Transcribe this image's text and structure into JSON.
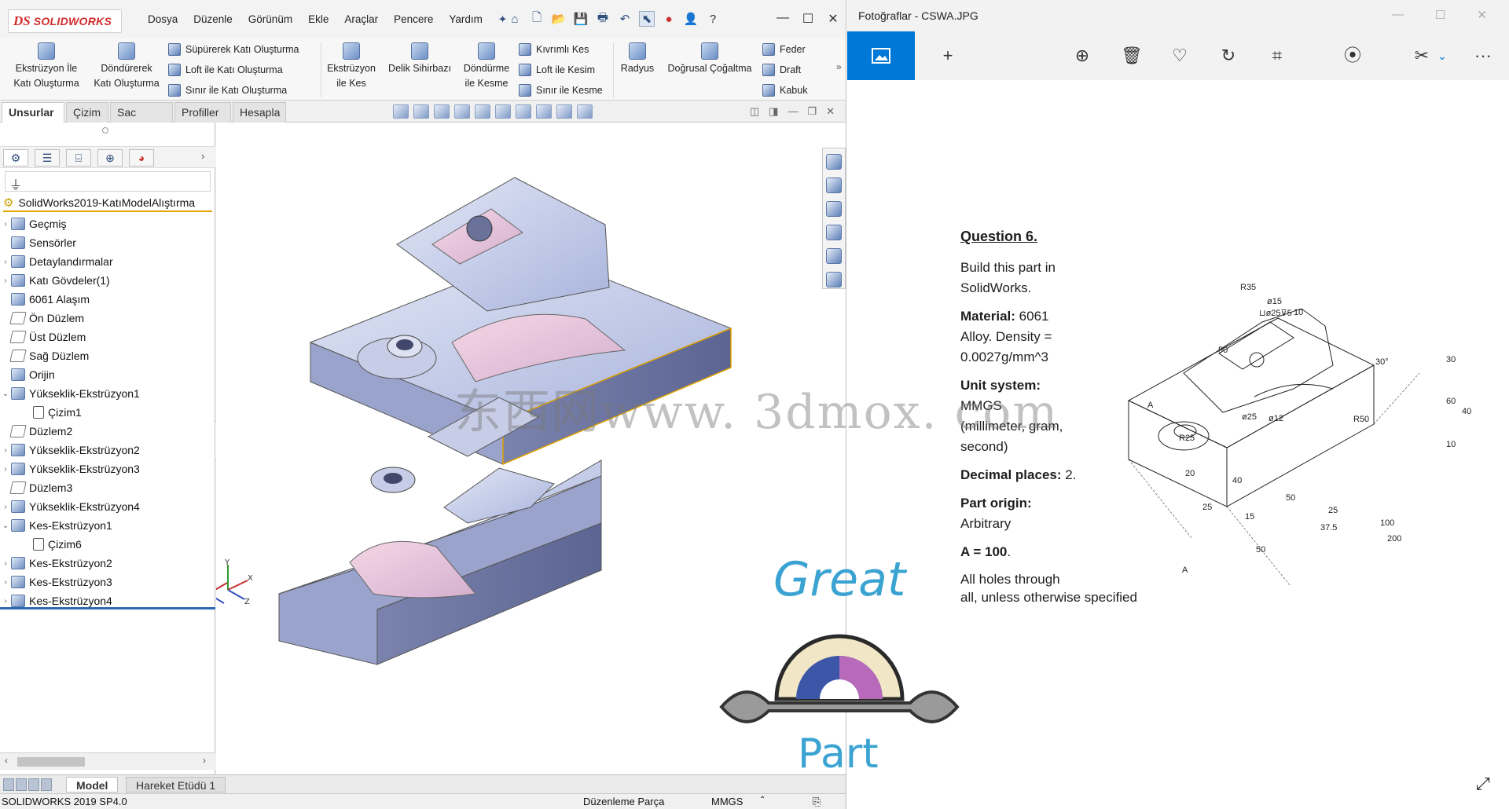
{
  "solidworks": {
    "logo_ds": "DS",
    "logo_name": "SOLIDWORKS",
    "menu": [
      "Dosya",
      "Düzenle",
      "Görünüm",
      "Ekle",
      "Araçlar",
      "Pencere",
      "Yardım"
    ],
    "ribbon": {
      "extrude_boss": "Ekstrüzyon İle\nKatı Oluşturma",
      "revolve_boss": "Döndürerek\nKatı Oluşturma",
      "sweep_boss": "Süpürerek Katı Oluşturma",
      "loft_boss": "Loft ile Katı Oluşturma",
      "boundary_boss": "Sınır ile Katı Oluşturma",
      "extrude_cut": "Ekstrüzyon\nile Kes",
      "hole_wizard": "Delik Sihirbazı",
      "revolve_cut": "Döndürme\nile Kesme",
      "swept_cut": "Kıvrımlı Kes",
      "loft_cut": "Loft ile Kesim",
      "boundary_cut": "Sınır ile Kesme",
      "fillet": "Radyus",
      "linear_pattern": "Doğrusal Çoğaltma",
      "rib": "Feder",
      "draft": "Draft",
      "shell": "Kabuk"
    },
    "tabs": [
      "Unsurlar",
      "Çizim",
      "Sac Levha",
      "Profiller",
      "Hesapla"
    ],
    "active_tab": "Unsurlar",
    "tree_root": "SolidWorks2019-KatıModelAlıştırma",
    "tree": [
      {
        "label": "Geçmiş",
        "arrow": "›",
        "icon": "history"
      },
      {
        "label": "Sensörler",
        "arrow": "",
        "icon": "sensor"
      },
      {
        "label": "Detaylandırmalar",
        "arrow": "›",
        "icon": "annotation"
      },
      {
        "label": "Katı Gövdeler(1)",
        "arrow": "›",
        "icon": "body"
      },
      {
        "label": "6061 Alaşım",
        "arrow": "",
        "icon": "material"
      },
      {
        "label": "Ön Düzlem",
        "arrow": "",
        "icon": "plane"
      },
      {
        "label": "Üst Düzlem",
        "arrow": "",
        "icon": "plane"
      },
      {
        "label": "Sağ Düzlem",
        "arrow": "",
        "icon": "plane"
      },
      {
        "label": "Orijin",
        "arrow": "",
        "icon": "origin"
      },
      {
        "label": "Yükseklik-Ekstrüzyon1",
        "arrow": "⌄",
        "icon": "feature"
      },
      {
        "label": "Çizim1",
        "arrow": "",
        "icon": "sketch",
        "indent": true
      },
      {
        "label": "Düzlem2",
        "arrow": "",
        "icon": "plane"
      },
      {
        "label": "Yükseklik-Ekstrüzyon2",
        "arrow": "›",
        "icon": "feature"
      },
      {
        "label": "Yükseklik-Ekstrüzyon3",
        "arrow": "›",
        "icon": "feature"
      },
      {
        "label": "Düzlem3",
        "arrow": "",
        "icon": "plane"
      },
      {
        "label": "Yükseklik-Ekstrüzyon4",
        "arrow": "›",
        "icon": "feature"
      },
      {
        "label": "Kes-Ekstrüzyon1",
        "arrow": "⌄",
        "icon": "feature"
      },
      {
        "label": "Çizim6",
        "arrow": "",
        "icon": "sketch",
        "indent": true
      },
      {
        "label": "Kes-Ekstrüzyon2",
        "arrow": "›",
        "icon": "feature"
      },
      {
        "label": "Kes-Ekstrüzyon3",
        "arrow": "›",
        "icon": "feature"
      },
      {
        "label": "Kes-Ekstrüzyon4",
        "arrow": "›",
        "icon": "feature"
      }
    ],
    "bottom_tabs": [
      "Model",
      "Hareket Etüdü 1"
    ],
    "status": {
      "version": "SOLIDWORKS 2019 SP4.0",
      "mode": "Düzenleme Parça",
      "units": "MMGS"
    }
  },
  "photos": {
    "title": "Fotoğraflar - CSWA.JPG",
    "sheet": {
      "question": "Question 6.",
      "build_1": "Build this part in",
      "build_2": "SolidWorks.",
      "material_label": "Material:",
      "material_value": "6061",
      "material_2": "Alloy.  Density =",
      "material_3": "0.0027g/mm^3",
      "unit_label": "Unit system:",
      "unit_value": "MMGS",
      "unit_2": "(millimeter, gram,",
      "unit_3": "second)",
      "decimal_label": "Decimal places:",
      "decimal_value": "2.",
      "origin_label": "Part origin:",
      "origin_value": "Arbitrary",
      "a_label": "A = 100",
      "holes_1": "All holes through",
      "holes_2": "all, unless otherwise specified"
    },
    "dims": [
      "R35",
      "ø15",
      "⊔ø25⊽5",
      "10",
      "50",
      "30°",
      "30",
      "60",
      "40",
      "R50",
      "10",
      "ø25",
      "ø12",
      "R25",
      "A",
      "20",
      "40",
      "50",
      "25",
      "25",
      "15",
      "37.5",
      "100",
      "200",
      "50",
      "A"
    ]
  },
  "overlay": {
    "watermark": "东西网www. 3dmox. com",
    "great": "Great",
    "part": "Part"
  }
}
